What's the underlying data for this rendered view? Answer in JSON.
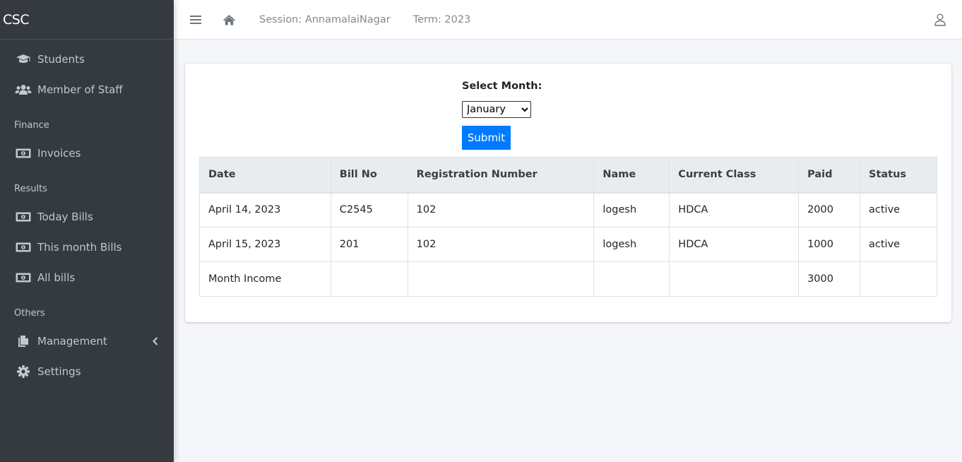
{
  "brand": "CSC",
  "sidebar": {
    "items_top": [
      {
        "label": "Students",
        "icon": "graduation-cap-icon"
      },
      {
        "label": "Member of Staff",
        "icon": "users-icon"
      }
    ],
    "finance_header": "Finance",
    "finance_items": [
      {
        "label": "Invoices",
        "icon": "money-bill-icon"
      }
    ],
    "results_header": "Results",
    "results_items": [
      {
        "label": "Today Bills",
        "icon": "money-bill-icon"
      },
      {
        "label": "This month Bills",
        "icon": "money-bill-icon"
      },
      {
        "label": "All bills",
        "icon": "money-bill-icon"
      }
    ],
    "others_header": "Others",
    "others_items": [
      {
        "label": "Management",
        "icon": "copy-icon"
      },
      {
        "label": "Settings",
        "icon": "gear-icon"
      }
    ]
  },
  "topbar": {
    "session": "Session: AnnamalaiNagar",
    "term": "Term: 2023"
  },
  "form": {
    "label": "Select Month:",
    "selected_month": "January",
    "submit_label": "Submit"
  },
  "table": {
    "headers": [
      "Date",
      "Bill No",
      "Registration Number",
      "Name",
      "Current Class",
      "Paid",
      "Status"
    ],
    "rows": [
      [
        "April 14, 2023",
        "C2545",
        "102",
        "logesh",
        "HDCA",
        "2000",
        "active"
      ],
      [
        "April 15, 2023",
        "201",
        "102",
        "logesh",
        "HDCA",
        "1000",
        "active"
      ],
      [
        "Month Income",
        "",
        "",
        "",
        "",
        "3000",
        ""
      ]
    ]
  },
  "colors": {
    "sidebar_bg": "#343a40",
    "primary": "#007bff",
    "page_bg": "#f4f6f9"
  }
}
